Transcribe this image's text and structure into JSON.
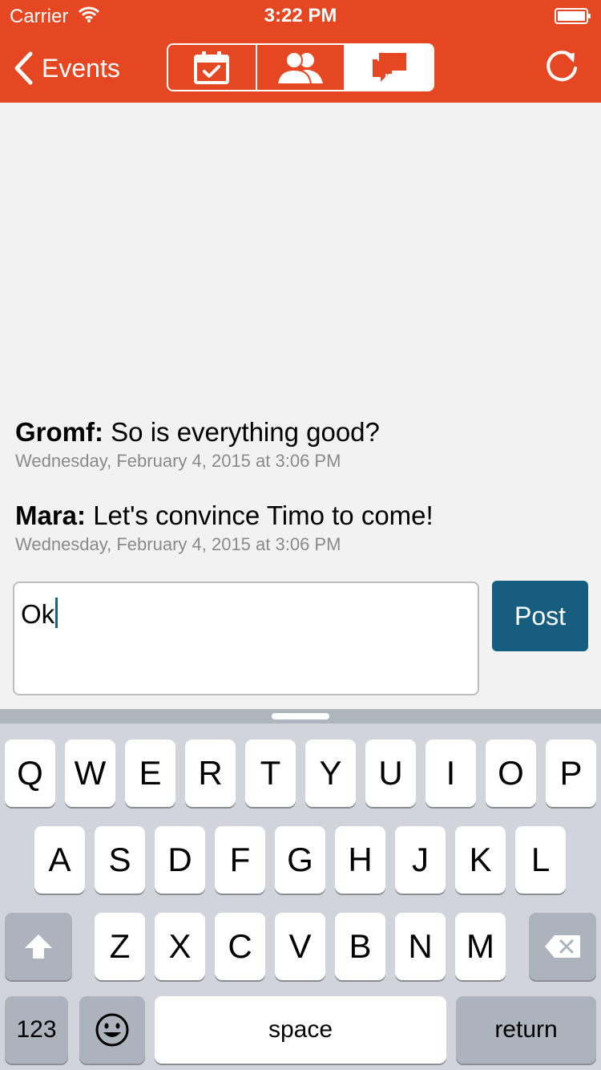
{
  "status": {
    "carrier": "Carrier",
    "time": "3:22 PM"
  },
  "nav": {
    "back_label": "Events"
  },
  "messages": [
    {
      "author": "Gromf:",
      "text": "So is everything good?",
      "time": "Wednesday, February 4, 2015 at 3:06 PM"
    },
    {
      "author": "Mara:",
      "text": "Let's convince Timo to come!",
      "time": "Wednesday, February 4, 2015 at 3:06 PM"
    }
  ],
  "composer": {
    "value": "Ok",
    "post_label": "Post"
  },
  "keyboard": {
    "row1": [
      "Q",
      "W",
      "E",
      "R",
      "T",
      "Y",
      "U",
      "I",
      "O",
      "P"
    ],
    "row2": [
      "A",
      "S",
      "D",
      "F",
      "G",
      "H",
      "J",
      "K",
      "L"
    ],
    "row3": [
      "Z",
      "X",
      "C",
      "V",
      "B",
      "N",
      "M"
    ],
    "numbers_label": "123",
    "space_label": "space",
    "return_label": "return"
  },
  "colors": {
    "brand": "#e44722",
    "post_button": "#175d7f",
    "keyboard_bg": "#d1d5db"
  },
  "icons": [
    "wifi-icon",
    "battery-icon",
    "chevron-left-icon",
    "calendar-check-icon",
    "people-icon",
    "chat-bubbles-icon",
    "refresh-icon",
    "shift-icon",
    "delete-icon",
    "emoji-icon"
  ]
}
